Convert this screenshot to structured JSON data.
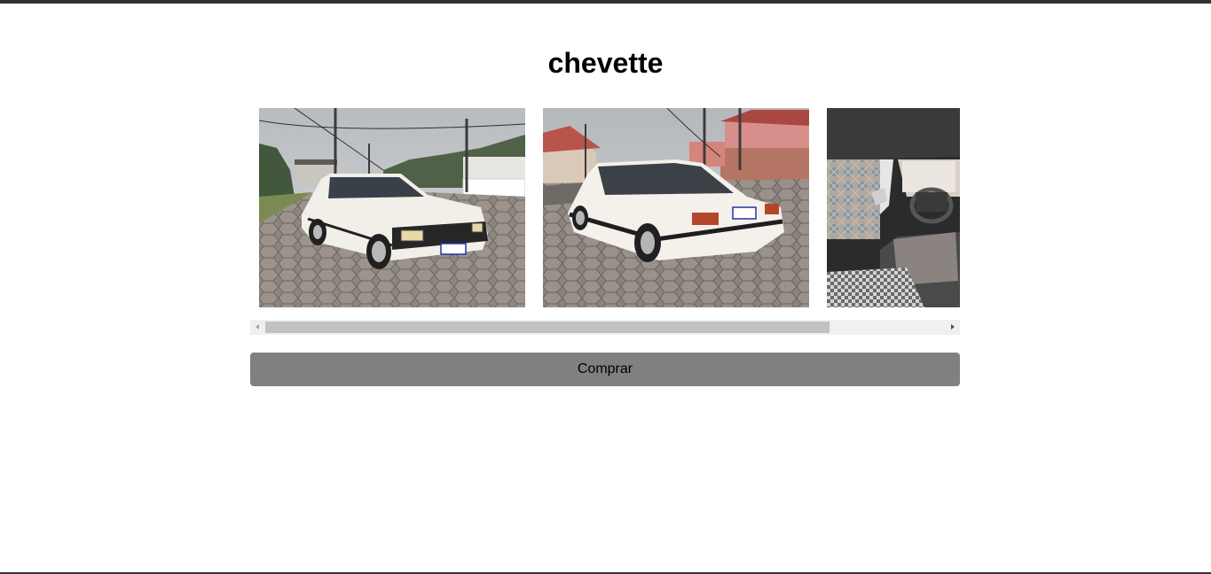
{
  "product": {
    "title": "chevette"
  },
  "gallery": {
    "photos": [
      {
        "alt": "chevette-front-three-quarter"
      },
      {
        "alt": "chevette-rear-three-quarter"
      },
      {
        "alt": "chevette-interior"
      }
    ],
    "scroll_fraction_visible": 0.83,
    "scroll_position": 0
  },
  "actions": {
    "buy_label": "Comprar"
  },
  "colors": {
    "button_bg": "#808080",
    "scrollbar_track": "#f0f0f0",
    "scrollbar_thumb": "#c1c1c1",
    "frame_bar": "#333333"
  }
}
